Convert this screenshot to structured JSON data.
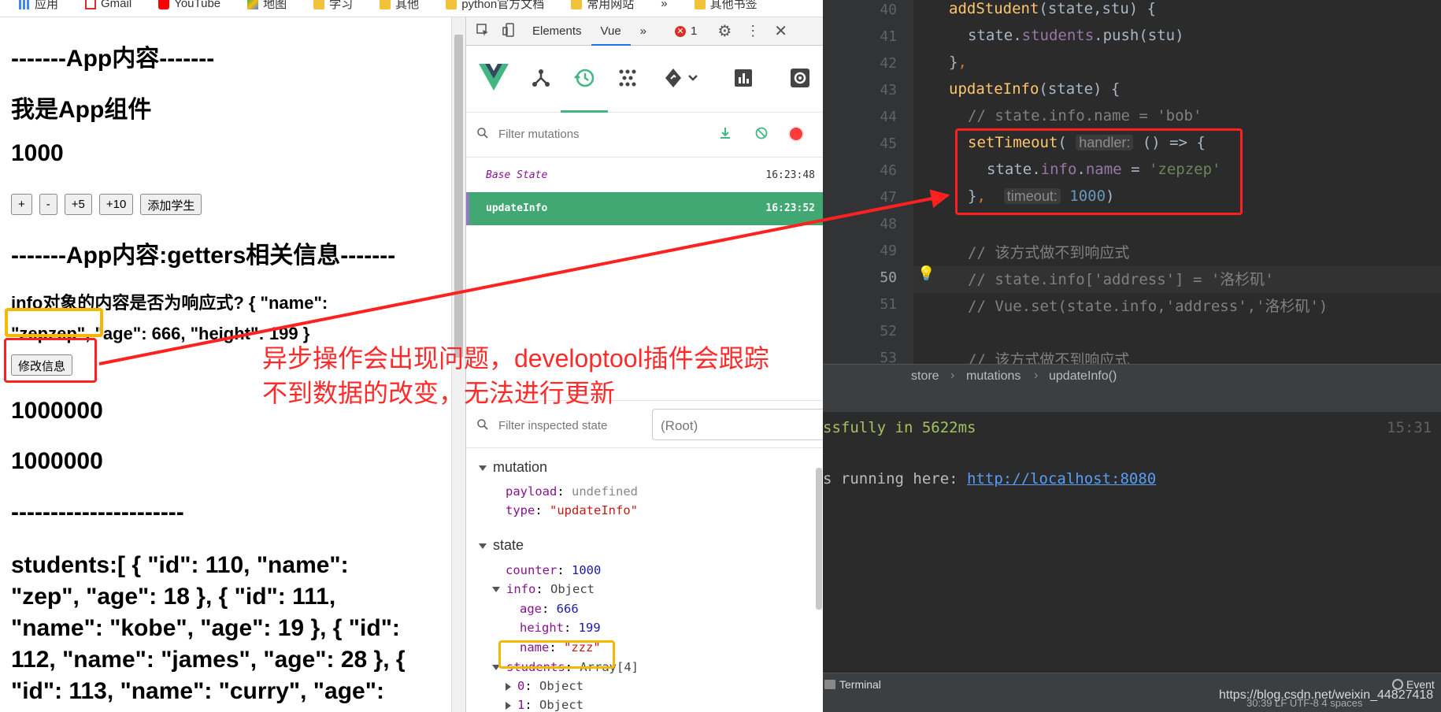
{
  "bookmarks": [
    "应用",
    "Gmail",
    "YouTube",
    "地图",
    "学习",
    "其他",
    "python官方文档",
    "常用网站",
    "»",
    "其他书签"
  ],
  "page": {
    "title1": "-------App内容-------",
    "title2": "我是App组件",
    "counter": "1000",
    "buttons": [
      "+",
      "-",
      "+5",
      "+10",
      "添加学生"
    ],
    "getters_title": "-------App内容:getters相关信息-------",
    "info_line1": "info对象的内容是否为响应式? { \"name\":",
    "info_name": "\"zepzep\",",
    "info_rest": " \"age\": 666, \"height\": 199 }",
    "modify_button": "修改信息",
    "big1": "1000000",
    "big2": "1000000",
    "divider": "----------------------",
    "students": [
      "students:[ { \"id\": 110, \"name\":",
      "\"zep\", \"age\": 18 }, { \"id\": 111,",
      "\"name\": \"kobe\", \"age\": 19 }, { \"id\":",
      "112, \"name\": \"james\", \"age\": 28 }, {",
      "\"id\": 113, \"name\": \"curry\", \"age\":"
    ]
  },
  "devtools": {
    "tabs": [
      "Elements",
      "Vue",
      "»"
    ],
    "error_count": "1",
    "filter_mutations": "Filter mutations",
    "mutations": [
      {
        "name": "Base State",
        "time": "16:23:48"
      },
      {
        "name": "updateInfo",
        "time": "16:23:52"
      }
    ],
    "filter_state": "Filter inspected state",
    "root": "(Root)",
    "mutation_section": "mutation",
    "payload_key": "payload",
    "payload_val": "undefined",
    "type_key": "type",
    "type_val": "\"updateInfo\"",
    "state_section": "state",
    "counter_key": "counter",
    "counter_val": "1000",
    "info_key": "info",
    "info_val": "Object",
    "age_key": "age",
    "age_val": "666",
    "height_key": "height",
    "height_val": "199",
    "name_key": "name",
    "name_val": "\"zzz\"",
    "students_key": "students",
    "students_val": "Array[4]",
    "s0_key": "0",
    "s0_val": "Object",
    "s1_key": "1",
    "s1_val": "Object"
  },
  "ide": {
    "line_numbers": [
      "40",
      "41",
      "42",
      "43",
      "44",
      "45",
      "46",
      "47",
      "48",
      "49",
      "50",
      "51",
      "52",
      "53"
    ],
    "breadcrumb": [
      "store",
      "mutations",
      "updateInfo()"
    ],
    "term_success": "ssfully in 5622ms",
    "term_time": "15:31",
    "term_running": "s running here: ",
    "term_url": "http://localhost:8080",
    "terminal_tab": "Terminal",
    "event_log": "Event",
    "status": "30:39  LF  UTF-8  4 spaces"
  },
  "annotation": {
    "line1": "异步操作会出现问题，developtool插件会跟踪",
    "line2": "不到数据的改变，无法进行更新"
  },
  "watermark": "https://blog.csdn.net/weixin_44827418",
  "colors": {
    "red": "#ff2020",
    "orange": "#f5b800",
    "vue_green": "#41b883",
    "selected_row": "#41a874"
  }
}
